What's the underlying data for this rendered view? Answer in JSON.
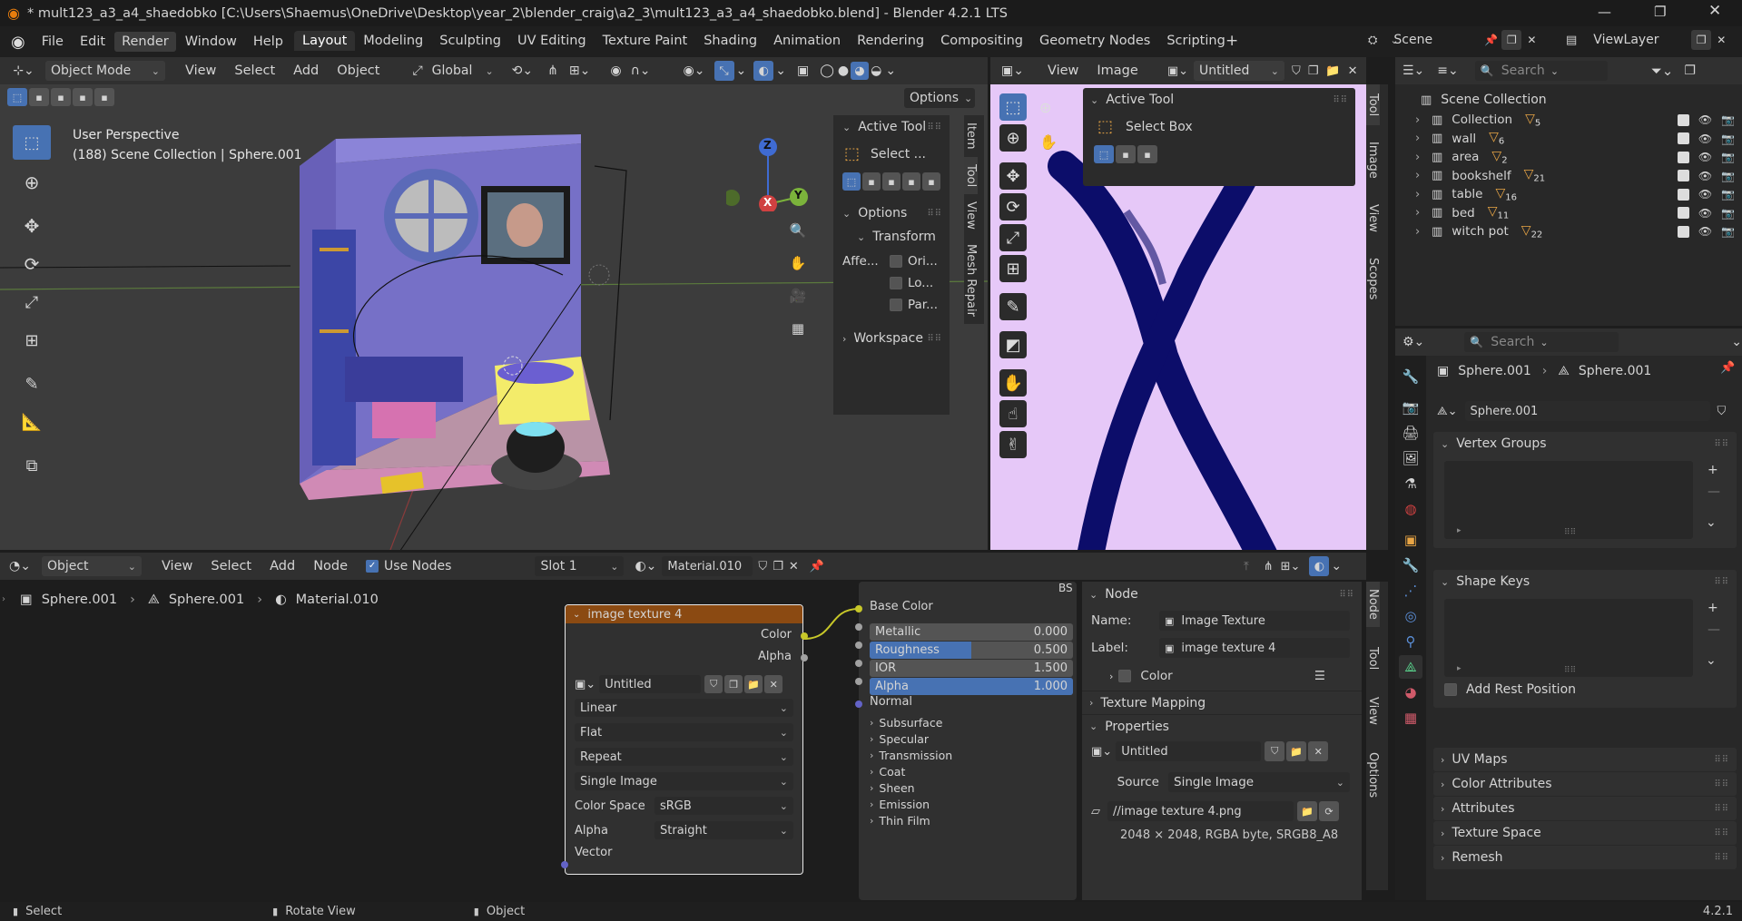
{
  "title_bar": {
    "title": "* mult123_a3_a4_shaedobko [C:\\Users\\Shaemus\\OneDrive\\Desktop\\year_2\\blender_craig\\a2_3\\mult123_a3_a4_shaedobko.blend] - Blender 4.2.1 LTS"
  },
  "menu": [
    "File",
    "Edit",
    "Render",
    "Window",
    "Help"
  ],
  "workspaces": [
    "Layout",
    "Modeling",
    "Sculpting",
    "UV Editing",
    "Texture Paint",
    "Shading",
    "Animation",
    "Rendering",
    "Compositing",
    "Geometry Nodes",
    "Scripting"
  ],
  "scene": {
    "scene_name": "Scene",
    "view_layer": "ViewLayer"
  },
  "viewport": {
    "mode": "Object Mode",
    "menus": [
      "View",
      "Select",
      "Add",
      "Object"
    ],
    "orientation": "Global",
    "options_label": "Options",
    "overlay_line1": "User Perspective",
    "overlay_line2": "(188) Scene Collection | Sphere.001",
    "gizmo": {
      "z": "Z",
      "y": "Y",
      "x": "X"
    },
    "tabs": [
      "Item",
      "Tool",
      "View",
      "Mesh Repair"
    ],
    "npanel": {
      "active_tool": "Active Tool",
      "tool_name": "Select ...",
      "options": "Options",
      "transform": "Transform",
      "affect": "Affe...",
      "checks": [
        "Ori...",
        "Lo...",
        "Par..."
      ],
      "workspace": "Workspace"
    }
  },
  "image_editor": {
    "menus": [
      "View",
      "Image"
    ],
    "image_name": "Untitled",
    "tabs": [
      "Tool",
      "Image",
      "View",
      "Scopes"
    ],
    "panel_title": "Active Tool",
    "tool": "Select Box"
  },
  "outliner": {
    "search_placeholder": "Search",
    "root": "Scene Collection",
    "items": [
      {
        "name": "Collection",
        "badge": "5"
      },
      {
        "name": "wall",
        "badge": "6"
      },
      {
        "name": "area",
        "badge": "2"
      },
      {
        "name": "bookshelf",
        "badge": "21"
      },
      {
        "name": "table",
        "badge": "16"
      },
      {
        "name": "bed",
        "badge": "11"
      },
      {
        "name": "witch pot",
        "badge": "22"
      }
    ]
  },
  "properties": {
    "search_placeholder": "Search",
    "breadcrumb_obj": "Sphere.001",
    "breadcrumb_data": "Sphere.001",
    "data_name": "Sphere.001",
    "vertex_groups": "Vertex Groups",
    "shape_keys": "Shape Keys",
    "add_rest_position": "Add Rest Position",
    "sections": [
      "UV Maps",
      "Color Attributes",
      "Attributes",
      "Texture Space",
      "Remesh"
    ]
  },
  "node_editor": {
    "type": "Object",
    "menus": [
      "View",
      "Select",
      "Add",
      "Node"
    ],
    "use_nodes": "Use Nodes",
    "slot": "Slot 1",
    "material": "Material.010",
    "breadcrumb": [
      "Sphere.001",
      "Sphere.001",
      "Material.010"
    ],
    "tabs": [
      "Node",
      "Tool",
      "View",
      "Options"
    ],
    "image_node": {
      "title": "image texture 4",
      "out_color": "Color",
      "out_alpha": "Alpha",
      "image": "Untitled",
      "interp": "Linear",
      "projection": "Flat",
      "extension": "Repeat",
      "source": "Single Image",
      "color_space_label": "Color Space",
      "color_space": "sRGB",
      "alpha_label": "Alpha",
      "alpha": "Straight",
      "vector": "Vector"
    },
    "bsdf": {
      "corner": "BS",
      "base_color": "Base Color",
      "metallic": {
        "label": "Metallic",
        "value": "0.000",
        "fraction": 0.0
      },
      "roughness": {
        "label": "Roughness",
        "value": "0.500",
        "fraction": 0.5
      },
      "ior": {
        "label": "IOR",
        "value": "1.500",
        "fraction": 0.0
      },
      "alpha": {
        "label": "Alpha",
        "value": "1.000",
        "fraction": 1.0
      },
      "normal": "Normal",
      "sections": [
        "Subsurface",
        "Specular",
        "Transmission",
        "Coat",
        "Sheen",
        "Emission",
        "Thin Film"
      ]
    },
    "side": {
      "node": "Node",
      "name_label": "Name:",
      "name_value": "Image Texture",
      "label_label": "Label:",
      "label_value": "image texture 4",
      "color": "Color",
      "texture_mapping": "Texture Mapping",
      "properties": "Properties",
      "image": "Untitled",
      "source_label": "Source",
      "source_value": "Single Image",
      "path": "//image texture 4.png",
      "info": "2048 × 2048,  RGBA byte, SRGB8_A8"
    }
  },
  "status_bar": {
    "select": "Select",
    "rotate": "Rotate View",
    "object": "Object",
    "version": "4.2.1"
  },
  "colors": {
    "accent": "#4772b3",
    "node_header": "#8b4a12",
    "image_bg": "#e6c8f8",
    "stroke": "#0c0d6a"
  }
}
